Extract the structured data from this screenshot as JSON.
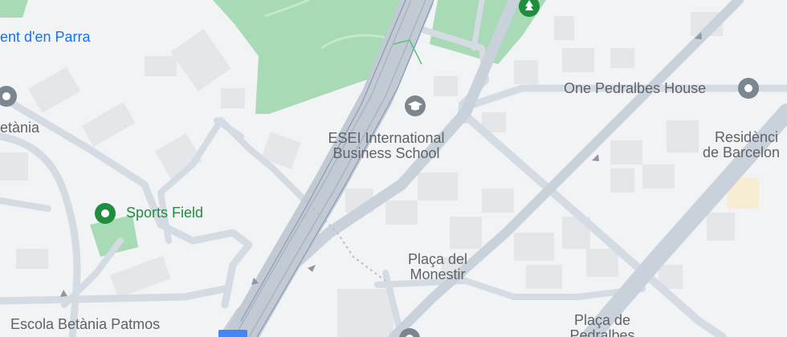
{
  "map": {
    "colors": {
      "background": "#f1f3f4",
      "park": "#a8dab5",
      "road": "#d4dbe3",
      "major_road": "#c2cad4",
      "building": "#e4e6e9",
      "poi_gray": "#7b868f",
      "poi_green": "#1e8e3e",
      "transit": "#4285f4"
    },
    "labels": {
      "top_left": "ent d'en Parra",
      "betania": "etània",
      "sports_field": "Sports Field",
      "esei_line1": "ESEI International",
      "esei_line2": "Business School",
      "one_pedralbes": "One Pedralbes House",
      "residencia_line1": "Residènci",
      "residencia_line2": "de Barcelon",
      "placa_monestir_line1": "Plaça del",
      "placa_monestir_line2": "Monestir",
      "escola": "Escola Betània Patmos",
      "placa_pedralbes_line1": "Plaça de",
      "placa_pedralbes_line2": "Pedralbes"
    },
    "icons": {
      "park_pin": "tree-icon",
      "school_pin": "graduation-cap-icon",
      "generic_pin": "location-pin-icon"
    }
  }
}
